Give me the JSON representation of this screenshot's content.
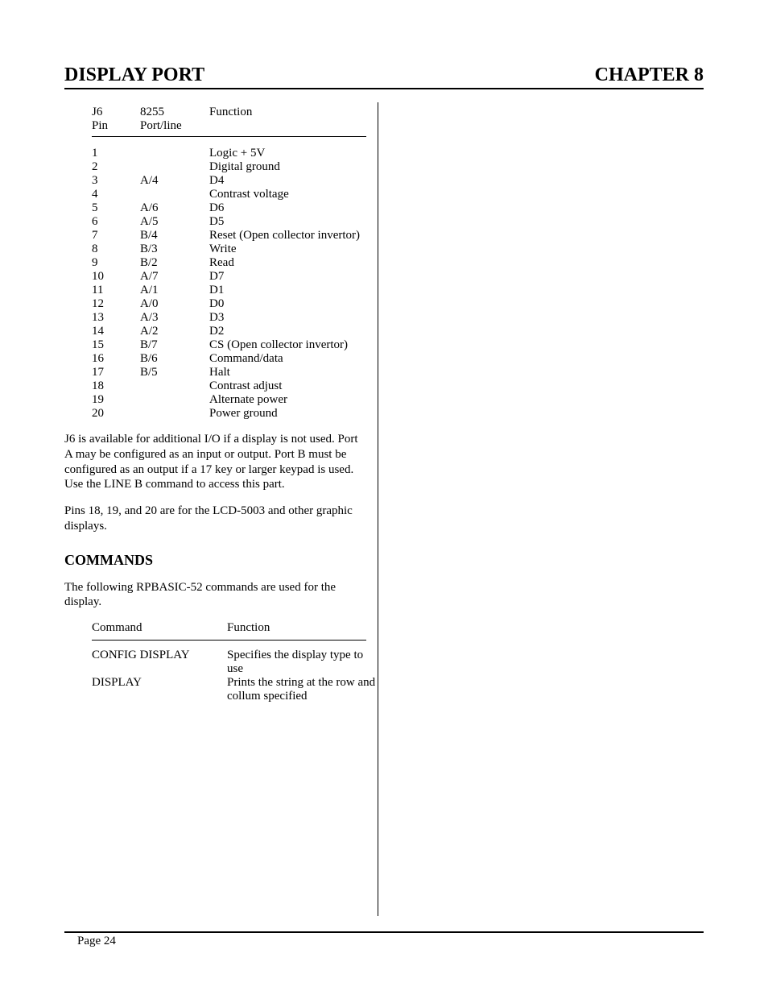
{
  "header": {
    "left": "DISPLAY PORT",
    "right": "CHAPTER 8"
  },
  "pin_table": {
    "headers": {
      "c1a": "J6",
      "c1b": "Pin",
      "c2a": "8255",
      "c2b": "Port/line",
      "c3a": "Function",
      "c3b": ""
    },
    "rows": [
      {
        "pin": "1",
        "port": "",
        "func": "Logic + 5V"
      },
      {
        "pin": "2",
        "port": "",
        "func": "Digital ground"
      },
      {
        "pin": "3",
        "port": "A/4",
        "func": "D4"
      },
      {
        "pin": "4",
        "port": "",
        "func": "Contrast voltage"
      },
      {
        "pin": "5",
        "port": "A/6",
        "func": "D6"
      },
      {
        "pin": "6",
        "port": "A/5",
        "func": "D5"
      },
      {
        "pin": "7",
        "port": "B/4",
        "func": "Reset (Open collector invertor)"
      },
      {
        "pin": "8",
        "port": "B/3",
        "func": "Write"
      },
      {
        "pin": "9",
        "port": "B/2",
        "func": "Read"
      },
      {
        "pin": "10",
        "port": "A/7",
        "func": "D7"
      },
      {
        "pin": "11",
        "port": "A/1",
        "func": "D1"
      },
      {
        "pin": "12",
        "port": "A/0",
        "func": "D0"
      },
      {
        "pin": "13",
        "port": "A/3",
        "func": "D3"
      },
      {
        "pin": "14",
        "port": "A/2",
        "func": "D2"
      },
      {
        "pin": "15",
        "port": "B/7",
        "func": "CS (Open collector invertor)"
      },
      {
        "pin": "16",
        "port": "B/6",
        "func": "Command/data"
      },
      {
        "pin": "17",
        "port": "B/5",
        "func": "Halt"
      },
      {
        "pin": "18",
        "port": "",
        "func": "Contrast adjust"
      },
      {
        "pin": "19",
        "port": "",
        "func": "Alternate power"
      },
      {
        "pin": "20",
        "port": "",
        "func": "Power ground"
      }
    ]
  },
  "paragraphs": {
    "p1": "J6 is available for additional I/O if a display is not used.  Port A may be configured as an input or output.  Port B must be configured as an output if a 17 key or larger keypad is used.  Use the LINE B command to access this part.",
    "p2": "Pins 18, 19, and 20 are for the LCD-5003 and other graphic displays."
  },
  "subhead": "COMMANDS",
  "commands_intro": "The following RPBASIC-52 commands are used for the display.",
  "cmd_table": {
    "headers": {
      "c1": "Command",
      "c2": "Function"
    },
    "rows": [
      {
        "cmd": "CONFIG DISPLAY",
        "func": "Specifies the display type to use"
      },
      {
        "cmd": "DISPLAY",
        "func": "Prints the string at the row and collum specified"
      }
    ]
  },
  "footer": "Page 24"
}
